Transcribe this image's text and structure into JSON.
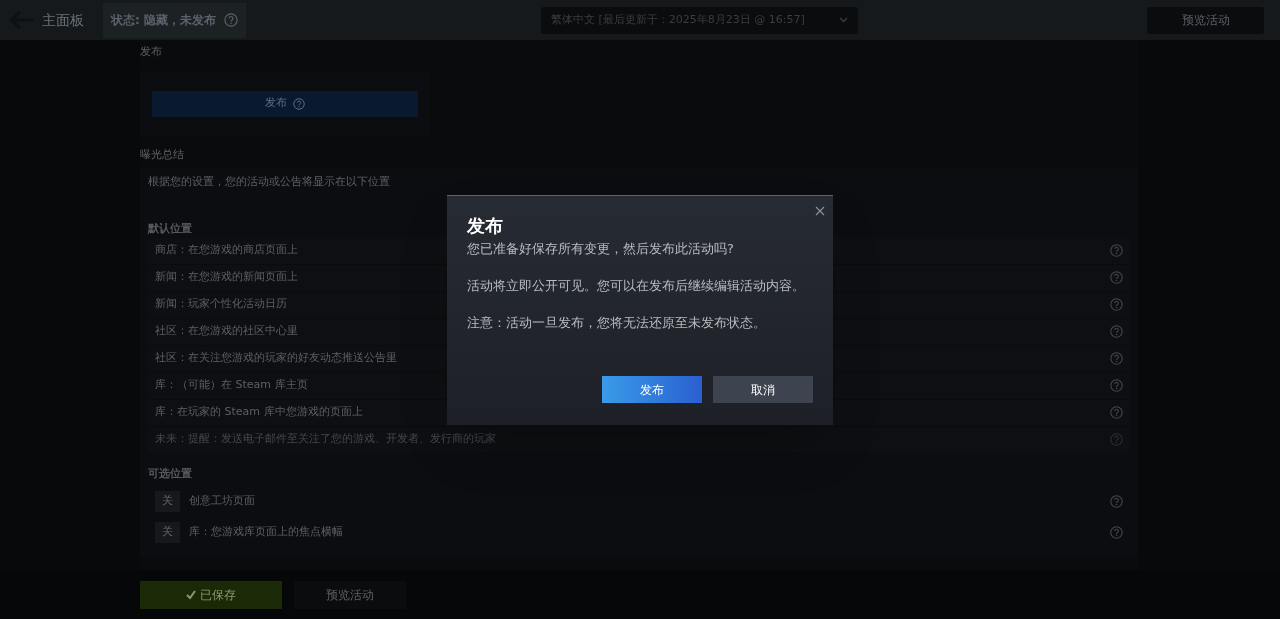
{
  "top_bar": {
    "back_label": "主面板",
    "status": "状态: 隐藏，未发布",
    "language_select": "繁体中文 [最后更新于：2025年8月23日 @ 16:57]",
    "preview_button": "预览活动"
  },
  "publish_section": {
    "heading": "发布",
    "button": "发布"
  },
  "exposure": {
    "heading": "曝光总结",
    "description": "根据您的设置，您的活动或公告将显示在以下位置",
    "default_heading": "默认位置",
    "default_rows": [
      {
        "text": "商店：在您游戏的商店页面上",
        "faded": false
      },
      {
        "text": "新闻：在您游戏的新闻页面上",
        "faded": false
      },
      {
        "text": "新闻：玩家个性化活动日历",
        "faded": false
      },
      {
        "text": "社区：在您游戏的社区中心里",
        "faded": false
      },
      {
        "text": "社区：在关注您游戏的玩家的好友动态推送公告里",
        "faded": false
      },
      {
        "text": "库：（可能）在 Steam 库主页",
        "faded": false
      },
      {
        "text": "库：在玩家的 Steam 库中您游戏的页面上",
        "faded": false
      },
      {
        "text": "未来：提醒：发送电子邮件至关注了您的游戏、开发者、发行商的玩家",
        "faded": true
      }
    ],
    "optional_heading": "可选位置",
    "optional_rows": [
      {
        "toggle": "关",
        "on": false,
        "text": "创意工坊页面"
      },
      {
        "toggle": "关",
        "on": false,
        "text": "库：您游戏库页面上的焦点横幅"
      }
    ]
  },
  "bottom_bar": {
    "saved_button": "已保存",
    "preview_button": "预览活动"
  },
  "dialog": {
    "title": "发布",
    "paragraphs": [
      "您已准备好保存所有变更，然后发布此活动吗?",
      "活动将立即公开可见。您可以在发布后继续编辑活动内容。",
      "注意：活动一旦发布，您将无法还原至未发布状态。"
    ],
    "confirm": "发布",
    "cancel": "取消"
  }
}
